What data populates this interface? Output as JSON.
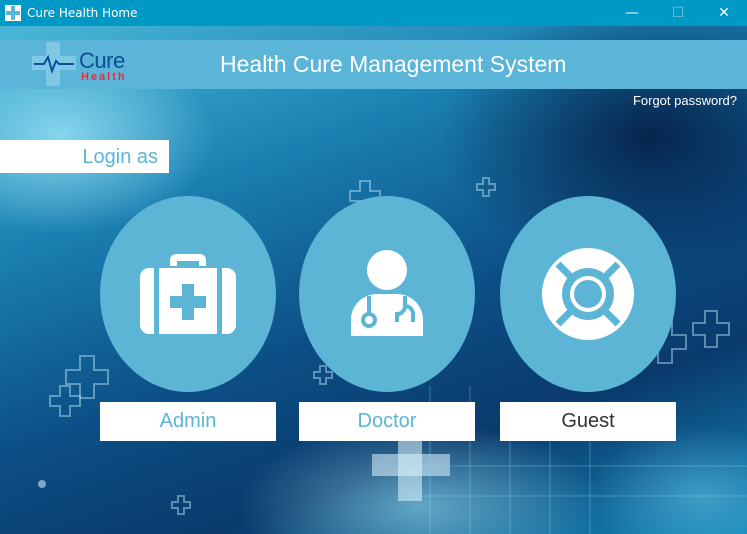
{
  "window": {
    "title": "Cure Health Home",
    "minimize_glyph": "—",
    "maximize_glyph": "☐",
    "close_glyph": "✕"
  },
  "header": {
    "logo_main": "Cure",
    "logo_sub": "Health",
    "title": "Health Cure Management System"
  },
  "forgot_password": "Forgot password?",
  "login_as": "Login as",
  "roles": [
    {
      "label": "Admin",
      "icon": "medical-kit-icon"
    },
    {
      "label": "Doctor",
      "icon": "doctor-icon"
    },
    {
      "label": "Guest",
      "icon": "lifebuoy-icon"
    }
  ],
  "colors": {
    "titlebar": "#0099c6",
    "accent": "#5bb5d8",
    "logo_blue": "#0d4e97",
    "logo_red": "#e3303a"
  }
}
